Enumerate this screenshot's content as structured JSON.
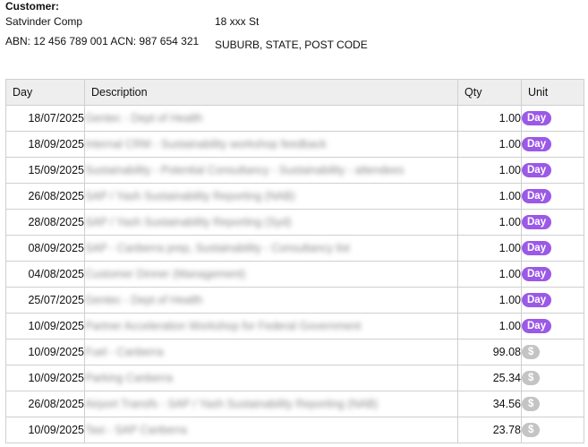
{
  "customer": {
    "heading": "Customer:",
    "name": "Satvinder Comp",
    "abn_acn": "ABN: 12 456 789 001 ACN: 987 654 321",
    "address_line1": "18 xxx St",
    "address_line2": "SUBURB, STATE, POST CODE"
  },
  "table": {
    "headers": {
      "day": "Day",
      "description": "Description",
      "qty": "Qty",
      "unit": "Unit"
    },
    "rows": [
      {
        "day": "18/07/2025",
        "description": "Gentec - Dept of Health",
        "qty": "1.00",
        "unit": "Day",
        "unit_type": "day"
      },
      {
        "day": "18/09/2025",
        "description": "Internal CRM - Sustainability workshop feedback",
        "qty": "1.00",
        "unit": "Day",
        "unit_type": "day"
      },
      {
        "day": "15/09/2025",
        "description": "Sustainability - Potential Consultancy - Sustainability - attendees",
        "qty": "1.00",
        "unit": "Day",
        "unit_type": "day"
      },
      {
        "day": "26/08/2025",
        "description": "SAP / Yash Sustainability Reporting (NAB)",
        "qty": "1.00",
        "unit": "Day",
        "unit_type": "day"
      },
      {
        "day": "28/08/2025",
        "description": "SAP / Yash Sustainability Reporting (Syd)",
        "qty": "1.00",
        "unit": "Day",
        "unit_type": "day"
      },
      {
        "day": "08/09/2025",
        "description": "SAP - Canberra prep, Sustainability - Consultancy list",
        "qty": "1.00",
        "unit": "Day",
        "unit_type": "day"
      },
      {
        "day": "04/08/2025",
        "description": "Customer Dinner (Management)",
        "qty": "1.00",
        "unit": "Day",
        "unit_type": "day"
      },
      {
        "day": "25/07/2025",
        "description": "Gentec - Dept of Health",
        "qty": "1.00",
        "unit": "Day",
        "unit_type": "day"
      },
      {
        "day": "10/09/2025",
        "description": "Partner Acceleration Workshop for Federal Government",
        "qty": "1.00",
        "unit": "Day",
        "unit_type": "day"
      },
      {
        "day": "10/09/2025",
        "description": "Fuel - Canberra",
        "qty": "99.08",
        "unit": "$",
        "unit_type": "dollar"
      },
      {
        "day": "10/09/2025",
        "description": "Parking Canberra",
        "qty": "25.34",
        "unit": "$",
        "unit_type": "dollar"
      },
      {
        "day": "26/08/2025",
        "description": "Airport Transfs - SAP / Yash Sustainability Reporting (NAB)",
        "qty": "34.56",
        "unit": "$",
        "unit_type": "dollar"
      },
      {
        "day": "10/09/2025",
        "description": "Taxi - SAP Canberra",
        "qty": "23.78",
        "unit": "$",
        "unit_type": "dollar"
      }
    ]
  },
  "colors": {
    "day_badge": "#9b59e6",
    "dollar_badge": "#c4c4c4",
    "header_bg": "#eeeeee"
  }
}
